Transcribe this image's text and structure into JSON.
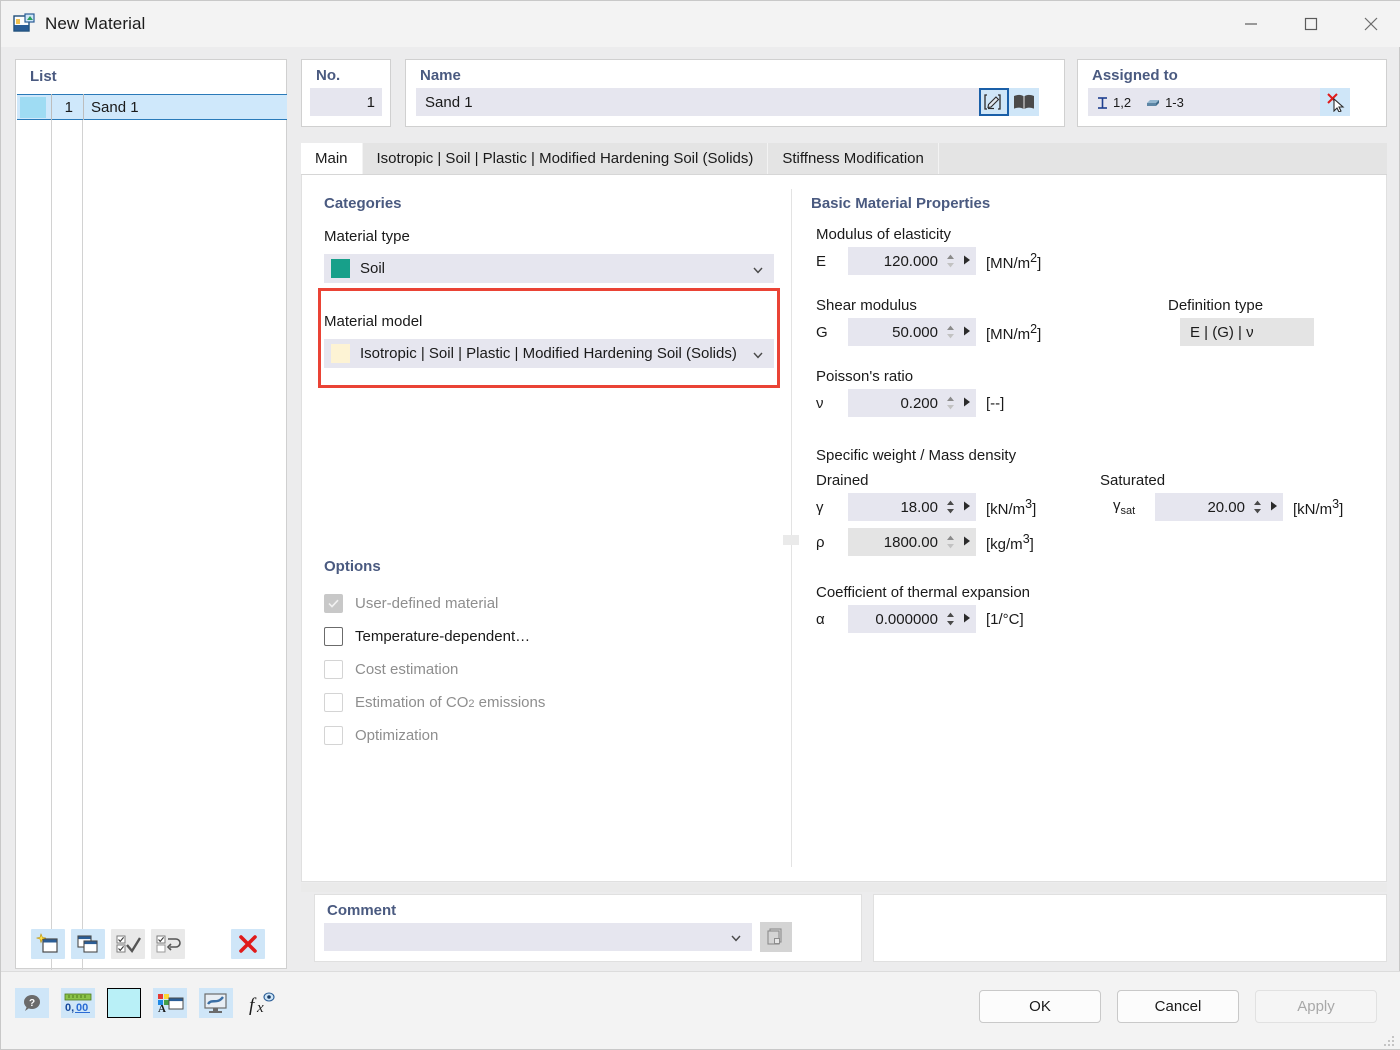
{
  "window": {
    "title": "New Material",
    "icon": "material-window-icon",
    "buttons": {
      "minimize": "minimize-icon",
      "maximize": "maximize-icon",
      "close": "close-icon"
    }
  },
  "list_panel": {
    "title": "List",
    "rows": [
      {
        "color_swatch": "#9fdcf3",
        "no": "1",
        "name": "Sand 1",
        "selected": true
      }
    ],
    "toolbar": [
      {
        "name": "new-material-button",
        "icon": "new-window-icon",
        "enabled": true
      },
      {
        "name": "copy-material-button",
        "icon": "copy-window-icon",
        "enabled": true
      },
      {
        "name": "select-all-button",
        "icon": "check-all-icon",
        "enabled": false
      },
      {
        "name": "invert-selection-button",
        "icon": "invert-selection-icon",
        "enabled": false
      },
      {
        "name": "delete-material-button",
        "icon": "red-x-icon",
        "enabled": true
      }
    ]
  },
  "header": {
    "no": {
      "label": "No.",
      "value": "1"
    },
    "name": {
      "label": "Name",
      "value": "Sand 1",
      "edit_button": "edit-pencil-icon",
      "library_button": "library-book-icon"
    },
    "assigned": {
      "label": "Assigned to",
      "member_icon": "i-section-icon",
      "member_value": "1,2",
      "surface_icon": "solid-icon",
      "surface_value": "1-3",
      "pick_button": "pick-deselect-icon"
    }
  },
  "tabs": [
    {
      "label": "Main",
      "active": true
    },
    {
      "label": "Isotropic | Soil | Plastic | Modified Hardening Soil (Solids)",
      "active": false
    },
    {
      "label": "Stiffness Modification",
      "active": false
    }
  ],
  "categories": {
    "title": "Categories",
    "material_type": {
      "label": "Material type",
      "value": "Soil",
      "swatch": "#17a08a"
    },
    "material_model": {
      "label": "Material model",
      "value": "Isotropic | Soil | Plastic | Modified Hardening Soil (Solids)",
      "swatch": "#fdf3d4",
      "highlight_color": "#ea4335"
    }
  },
  "options": {
    "title": "Options",
    "items": [
      {
        "label": "User-defined material",
        "checked": true,
        "enabled": false
      },
      {
        "label": "Temperature-dependent…",
        "checked": false,
        "enabled": true
      },
      {
        "label": "Cost estimation",
        "checked": false,
        "enabled": false
      },
      {
        "label": "Estimation of CO2 emissions",
        "checked": false,
        "enabled": false
      },
      {
        "label": "Optimization",
        "checked": false,
        "enabled": false
      }
    ]
  },
  "basic_properties": {
    "title": "Basic Material Properties",
    "modulus": {
      "heading": "Modulus of elasticity",
      "symbol": "E",
      "value": "120.000",
      "unit_prefix": "[MN/m",
      "unit_sup": "2",
      "unit_suffix": "]"
    },
    "shear": {
      "heading": "Shear modulus",
      "symbol": "G",
      "value": "50.000",
      "unit_prefix": "[MN/m",
      "unit_sup": "2",
      "unit_suffix": "]"
    },
    "poisson": {
      "heading": "Poisson's ratio",
      "symbol": "ν",
      "value": "0.200",
      "unit": "[--]"
    },
    "definition_type": {
      "heading": "Definition type",
      "value": "E | (G) | ν"
    },
    "density": {
      "heading": "Specific weight / Mass density",
      "drained_label": "Drained",
      "saturated_label": "Saturated",
      "gamma": {
        "symbol": "γ",
        "value": "18.00",
        "unit_prefix": "[kN/m",
        "unit_sup": "3",
        "unit_suffix": "]"
      },
      "rho": {
        "symbol": "ρ",
        "value": "1800.00",
        "unit_prefix": "[kg/m",
        "unit_sup": "3",
        "unit_suffix": "]"
      },
      "gamma_sat": {
        "symbol": "γ",
        "symbol_sub": "sat",
        "value": "20.00",
        "unit_prefix": "[kN/m",
        "unit_sup": "3",
        "unit_suffix": "]"
      }
    },
    "thermal": {
      "heading": "Coefficient of thermal expansion",
      "symbol": "α",
      "value": "0.000000",
      "unit": "[1/°C]"
    }
  },
  "comment": {
    "title": "Comment",
    "value": "",
    "placeholder": "",
    "copy_button": "copy-comment-icon"
  },
  "bottom_toolbar": [
    {
      "name": "help-button",
      "icon": "help-bubble-icon"
    },
    {
      "name": "units-button",
      "icon": "decimal-places-icon"
    },
    {
      "name": "color-button",
      "icon": "color-swatch-icon"
    },
    {
      "name": "display-properties-button",
      "icon": "display-props-icon"
    },
    {
      "name": "render-button",
      "icon": "render-monitor-icon"
    },
    {
      "name": "formula-button",
      "icon": "fx-icon"
    }
  ],
  "dialog_buttons": {
    "ok": "OK",
    "cancel": "Cancel",
    "apply": "Apply",
    "apply_enabled": false
  }
}
